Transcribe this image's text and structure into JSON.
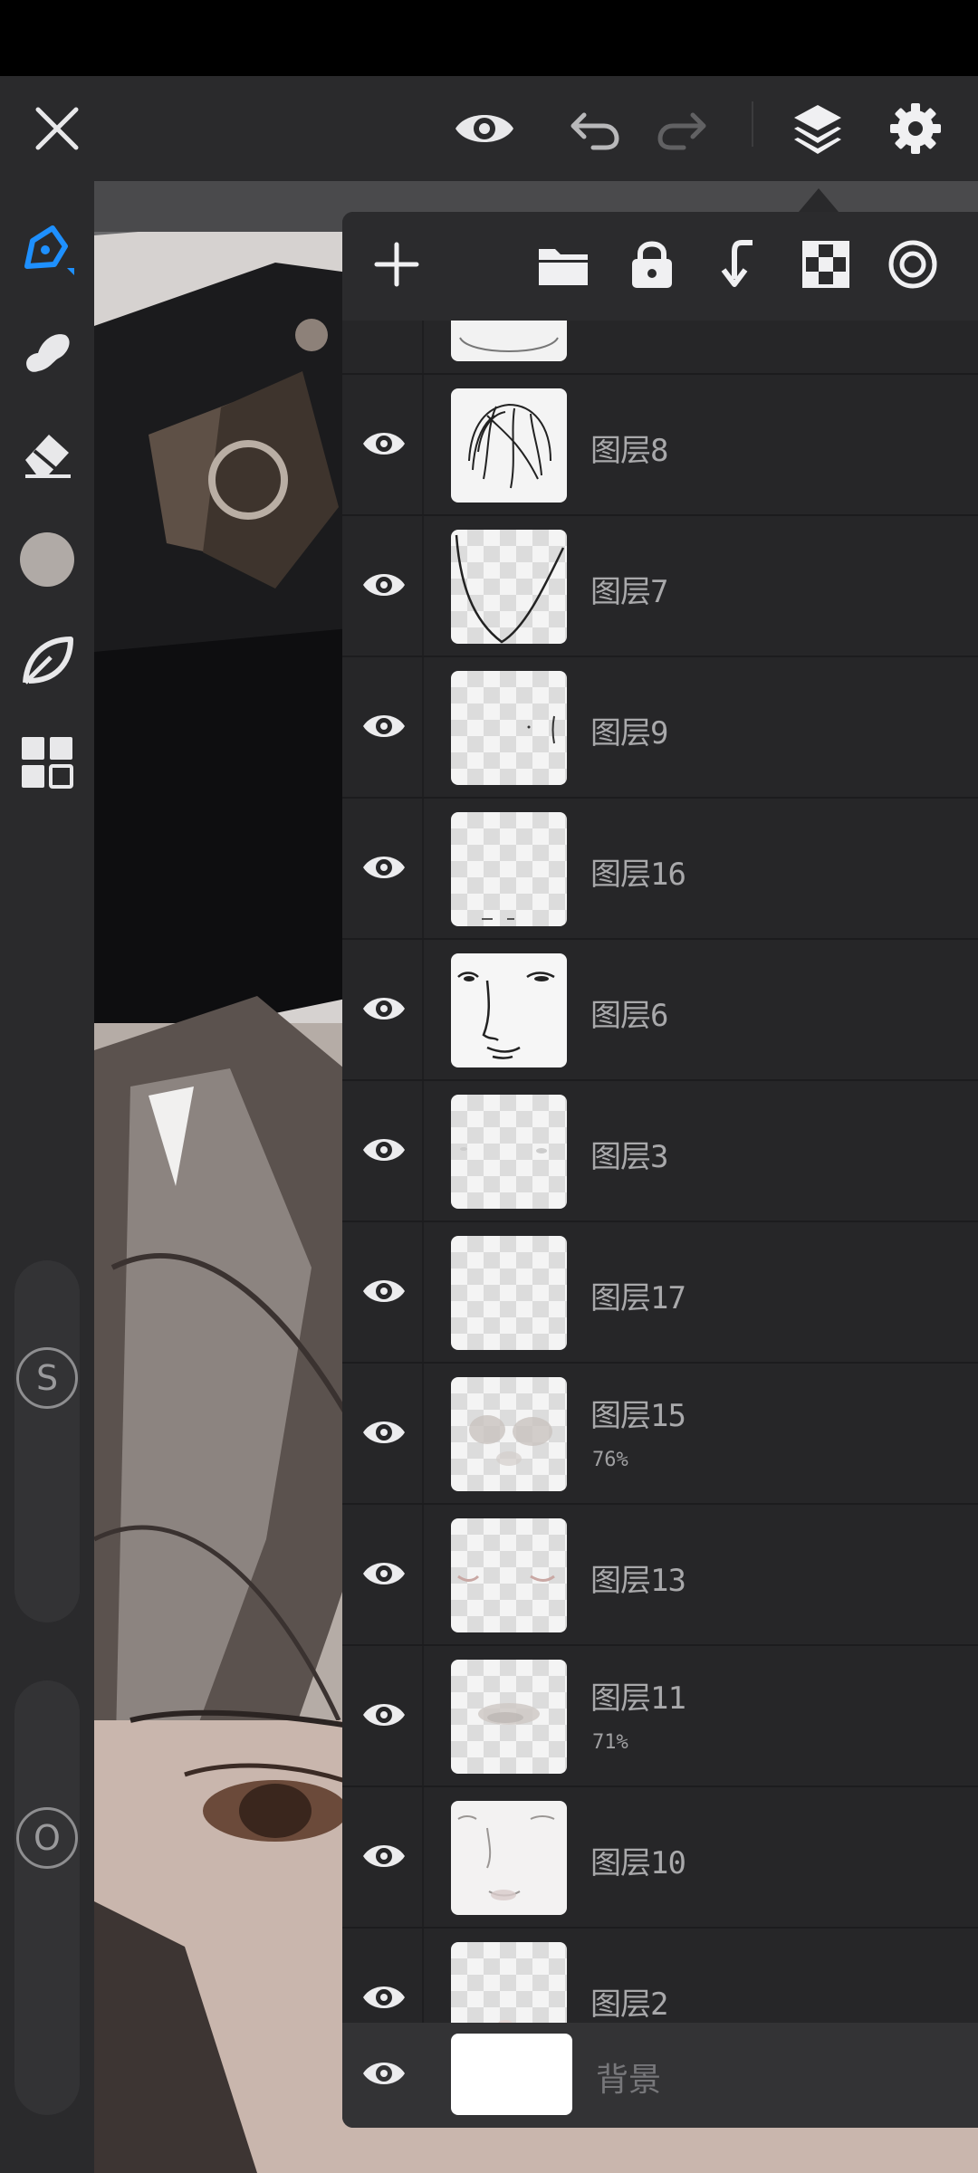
{
  "toolbar": {
    "close_icon": "close-icon",
    "preview_icon": "eye-icon",
    "undo_icon": "undo-icon",
    "redo_icon": "redo-icon",
    "layers_icon": "layers-icon",
    "settings_icon": "gear-icon",
    "accent_color": "#1e90ff"
  },
  "tools": [
    {
      "name": "brush",
      "icon": "pen-icon",
      "active": true
    },
    {
      "name": "smudge",
      "icon": "smudge-icon",
      "active": false
    },
    {
      "name": "eraser",
      "icon": "eraser-icon",
      "active": false
    },
    {
      "name": "color",
      "icon": "color-swatch",
      "color": "#b0aaa6",
      "active": false
    },
    {
      "name": "leaf",
      "icon": "leaf-icon",
      "active": false
    },
    {
      "name": "gallery",
      "icon": "grid-icon",
      "active": false
    }
  ],
  "sliders": {
    "size_label": "S",
    "opacity_label": "O"
  },
  "layer_panel": {
    "actions": [
      "add-layer-icon",
      "folder-icon",
      "lock-icon",
      "merge-down-icon",
      "transparency-icon",
      "blend-mode-icon"
    ],
    "layers": [
      {
        "name": "图层8",
        "opacity": "",
        "visible": true
      },
      {
        "name": "图层7",
        "opacity": "",
        "visible": true
      },
      {
        "name": "图层9",
        "opacity": "",
        "visible": true
      },
      {
        "name": "图层16",
        "opacity": "",
        "visible": true
      },
      {
        "name": "图层6",
        "opacity": "",
        "visible": true
      },
      {
        "name": "图层3",
        "opacity": "",
        "visible": true
      },
      {
        "name": "图层17",
        "opacity": "",
        "visible": true
      },
      {
        "name": "图层15",
        "opacity": "76%",
        "visible": true
      },
      {
        "name": "图层13",
        "opacity": "",
        "visible": true
      },
      {
        "name": "图层11",
        "opacity": "71%",
        "visible": true
      },
      {
        "name": "图层10",
        "opacity": "",
        "visible": true
      },
      {
        "name": "图层2",
        "opacity": "",
        "visible": true
      }
    ],
    "background": {
      "name": "背景",
      "visible": true
    }
  }
}
